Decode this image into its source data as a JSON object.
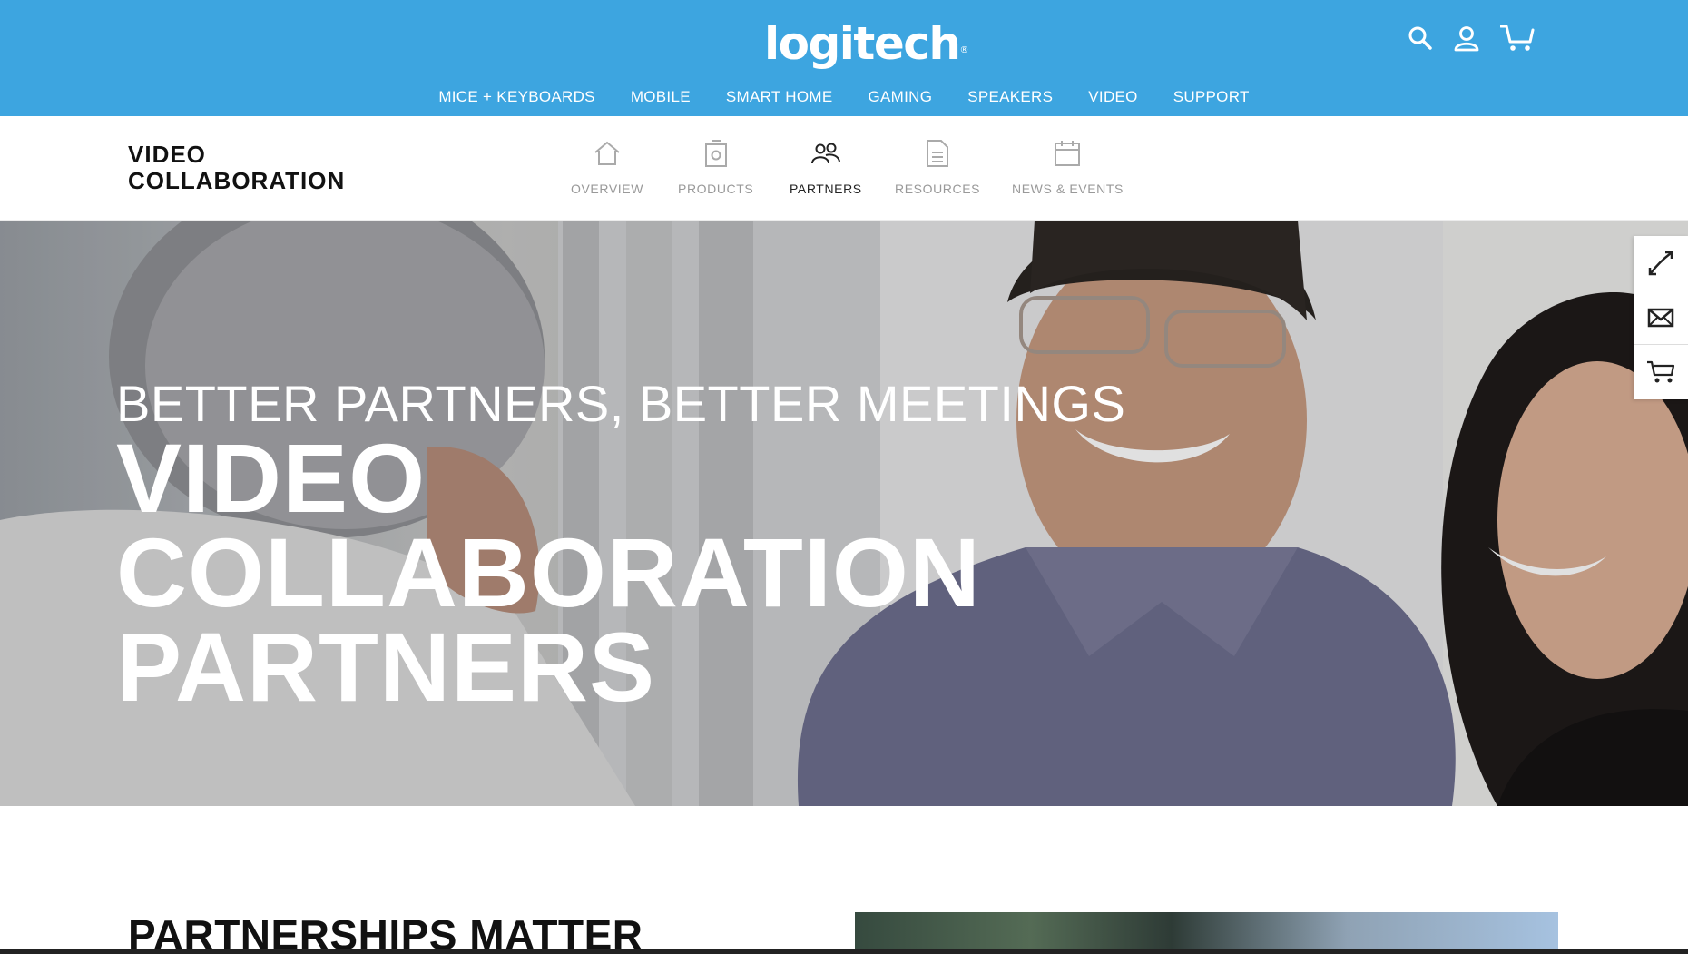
{
  "header": {
    "logo_text": "logitech",
    "logo_mark": "®",
    "brand_color": "#3da5e0",
    "nav": [
      "MICE + KEYBOARDS",
      "MOBILE",
      "SMART HOME",
      "GAMING",
      "SPEAKERS",
      "VIDEO",
      "SUPPORT"
    ],
    "icons": [
      "search-icon",
      "account-icon",
      "cart-icon"
    ]
  },
  "subnav": {
    "section_title_line1": "VIDEO",
    "section_title_line2": "COLLABORATION",
    "tabs": [
      {
        "label": "OVERVIEW",
        "icon": "home-icon",
        "active": false
      },
      {
        "label": "PRODUCTS",
        "icon": "products-icon",
        "active": false
      },
      {
        "label": "PARTNERS",
        "icon": "partners-icon",
        "active": true
      },
      {
        "label": "RESOURCES",
        "icon": "document-icon",
        "active": false
      },
      {
        "label": "NEWS & EVENTS",
        "icon": "calendar-icon",
        "active": false
      }
    ]
  },
  "hero": {
    "subtitle": "BETTER PARTNERS, BETTER MEETINGS",
    "title_lines": [
      "VIDEO",
      "COLLABORATION",
      "PARTNERS"
    ]
  },
  "rail": {
    "icons": [
      "phone-icon",
      "mail-icon",
      "cart-icon"
    ]
  },
  "section": {
    "heading": "PARTNERSHIPS MATTER"
  }
}
